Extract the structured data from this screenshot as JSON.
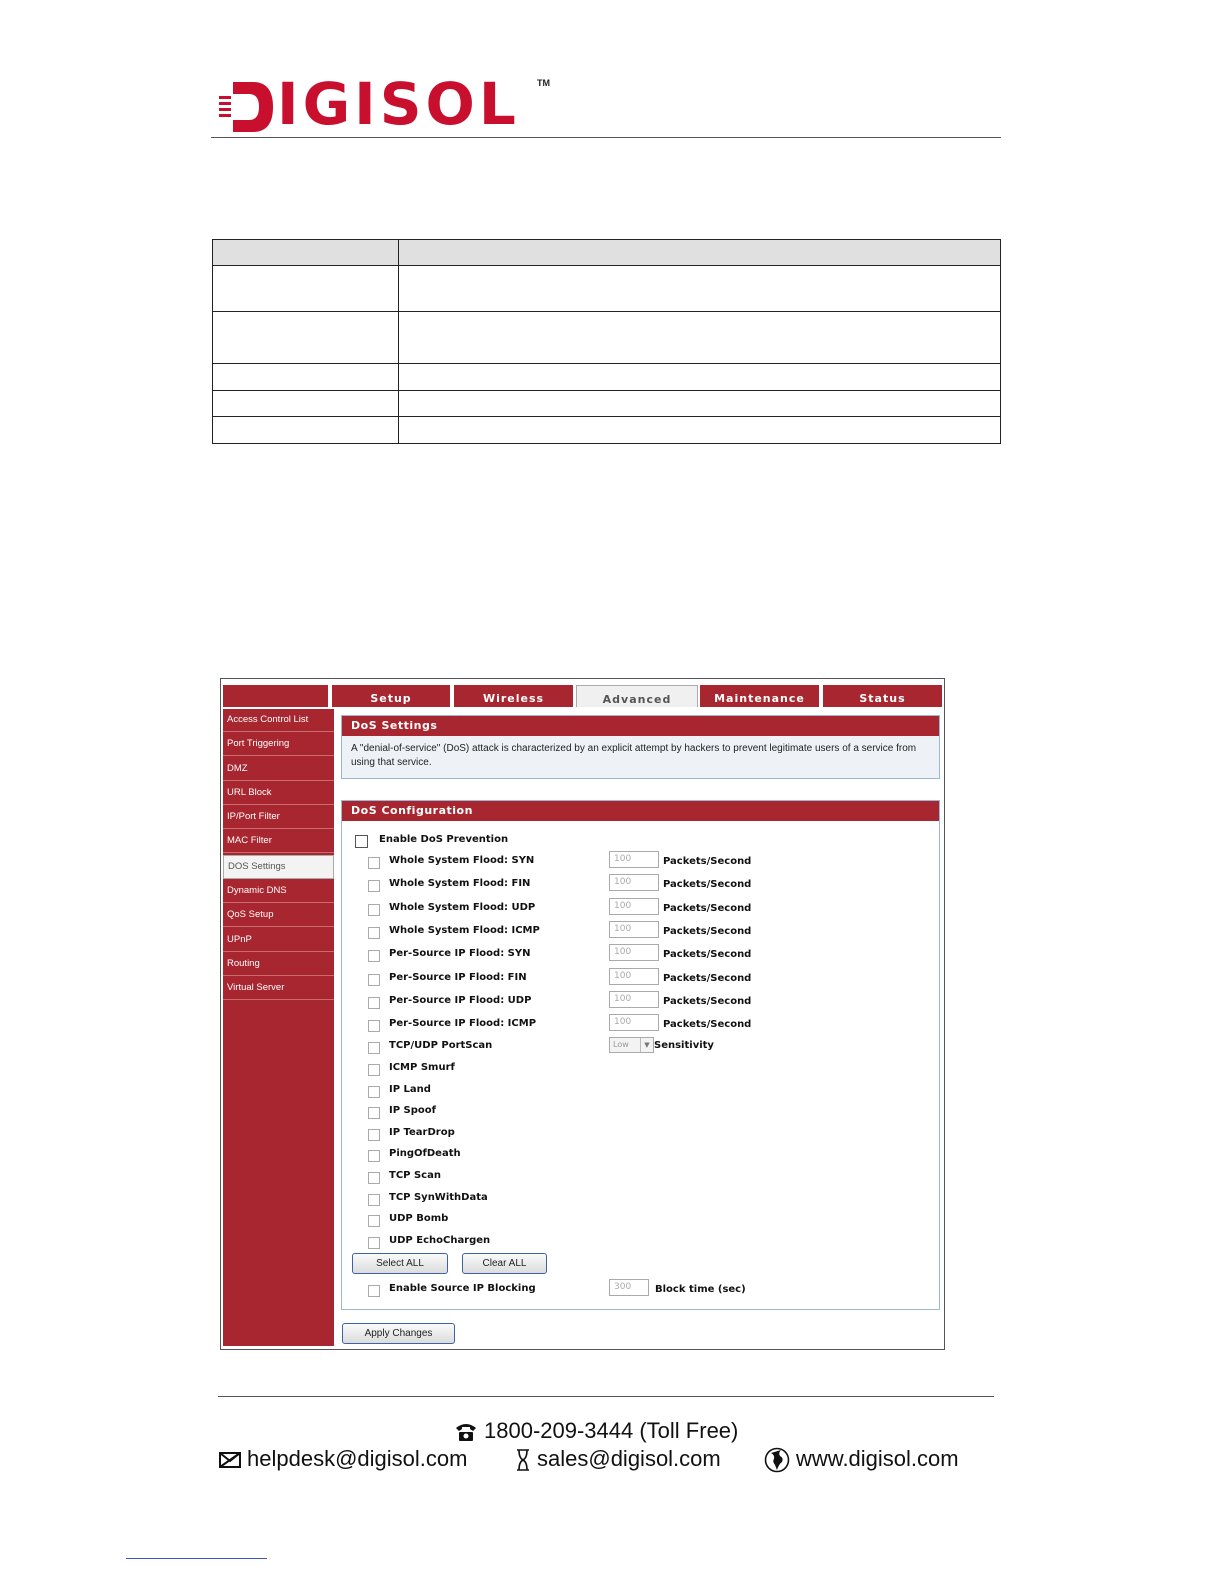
{
  "brand": {
    "logo_text": "IGISOL",
    "trademark": "TM",
    "accent_color": "#c8102e"
  },
  "router_ui": {
    "top_tabs": [
      "Setup",
      "Wireless",
      "Advanced",
      "Maintenance",
      "Status"
    ],
    "active_tab": "Advanced",
    "sidebar": [
      "Access Control List",
      "Port Triggering",
      "DMZ",
      "URL Block",
      "IP/Port Filter",
      "MAC Filter",
      "DOS Settings",
      "Dynamic DNS",
      "QoS Setup",
      "UPnP",
      "Routing",
      "Virtual Server"
    ],
    "active_sidebar": "DOS Settings",
    "dos_settings": {
      "title": "DoS Settings",
      "description": "A \"denial-of-service\" (DoS) attack is characterized by an explicit attempt by hackers to prevent legitimate users of a service from using that service."
    },
    "dos_config": {
      "title": "DoS Configuration",
      "enable_label": "Enable DoS Prevention",
      "flood_rows": [
        {
          "label": "Whole System Flood: SYN",
          "value": "100",
          "unit": "Packets/Second"
        },
        {
          "label": "Whole System Flood: FIN",
          "value": "100",
          "unit": "Packets/Second"
        },
        {
          "label": "Whole System Flood: UDP",
          "value": "100",
          "unit": "Packets/Second"
        },
        {
          "label": "Whole System Flood: ICMP",
          "value": "100",
          "unit": "Packets/Second"
        },
        {
          "label": "Per-Source IP Flood: SYN",
          "value": "100",
          "unit": "Packets/Second"
        },
        {
          "label": "Per-Source IP Flood: FIN",
          "value": "100",
          "unit": "Packets/Second"
        },
        {
          "label": "Per-Source IP Flood: UDP",
          "value": "100",
          "unit": "Packets/Second"
        },
        {
          "label": "Per-Source IP Flood: ICMP",
          "value": "100",
          "unit": "Packets/Second"
        }
      ],
      "portscan": {
        "label": "TCP/UDP PortScan",
        "select_value": "Low",
        "unit": "Sensitivity"
      },
      "simple_rows": [
        "ICMP Smurf",
        "IP Land",
        "IP Spoof",
        "IP TearDrop",
        "PingOfDeath",
        "TCP Scan",
        "TCP SynWithData",
        "UDP Bomb",
        "UDP EchoChargen"
      ],
      "select_all": "Select ALL",
      "clear_all": "Clear ALL",
      "source_block": {
        "label": "Enable Source IP Blocking",
        "value": "300",
        "unit": "Block time (sec)"
      }
    },
    "apply_button": "Apply Changes"
  },
  "footer": {
    "phone": "1800-209-3444 (Toll Free)",
    "helpdesk": "helpdesk@digisol.com",
    "sales": "sales@digisol.com",
    "website": "www.digisol.com"
  }
}
